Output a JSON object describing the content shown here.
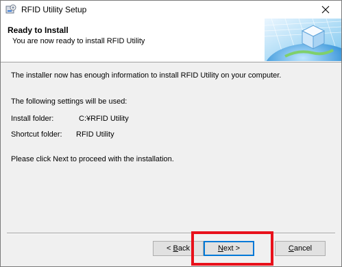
{
  "window": {
    "title": "RFID Utility Setup"
  },
  "header": {
    "title": "Ready to Install",
    "subtitle": "You are now ready to install RFID Utility"
  },
  "content": {
    "line1": "The installer now has enough information to install RFID Utility on your computer.",
    "line2": "The following settings will be used:",
    "install_folder_label": "Install folder:",
    "install_folder_value": "C:¥RFID Utility",
    "shortcut_folder_label": "Shortcut folder:",
    "shortcut_folder_value": "RFID Utility",
    "proceed_text": "Please click Next to proceed with the installation."
  },
  "buttons": {
    "back_prefix": "< ",
    "back_mnemonic": "B",
    "back_rest": "ack",
    "next_mnemonic": "N",
    "next_rest": "ext >",
    "cancel_mnemonic": "C",
    "cancel_rest": "ancel"
  },
  "icons": {
    "app": "installer-icon",
    "close": "close-icon",
    "banner": "globe-cube-banner"
  },
  "colors": {
    "highlight": "#e8111b",
    "focus": "#0078d7"
  }
}
